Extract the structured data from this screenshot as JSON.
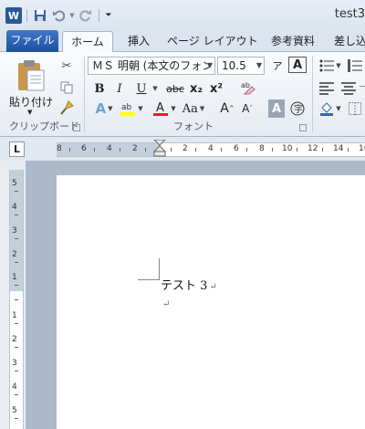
{
  "window": {
    "title": "test3"
  },
  "qat": {
    "app_icon": "W"
  },
  "tabs": [
    "ファイル",
    "ホーム",
    "挿入",
    "ページ レイアウト",
    "参考資料",
    "差し込"
  ],
  "clipboard": {
    "paste_label": "貼り付け",
    "group_label": "クリップボード"
  },
  "font": {
    "name": "ＭＳ 明朝 (本文のフォン",
    "size": "10.5",
    "group_label": "フォント"
  },
  "format_buttons": {
    "bold": "B",
    "italic": "I",
    "underline": "U",
    "strike": "abc",
    "subscript": "x₂",
    "superscript": "x²",
    "change_case": "Aa",
    "grow": "A",
    "shrink": "A",
    "clear": "A"
  },
  "ruler": {
    "h_numbers": [
      "8",
      "6",
      "4",
      "2",
      "2",
      "4",
      "6",
      "8",
      "10",
      "12",
      "14",
      "16"
    ],
    "v_numbers": [
      "5",
      "4",
      "3",
      "2",
      "1",
      "1",
      "2",
      "3",
      "4",
      "5"
    ],
    "tab_selector": "L"
  },
  "document": {
    "paragraphs": [
      "テスト 3",
      ""
    ],
    "para_mark": "↵"
  },
  "colors": {
    "accent": "#2b5797",
    "file_tab": "#1d4f9e",
    "canvas": "#abb9cb"
  }
}
